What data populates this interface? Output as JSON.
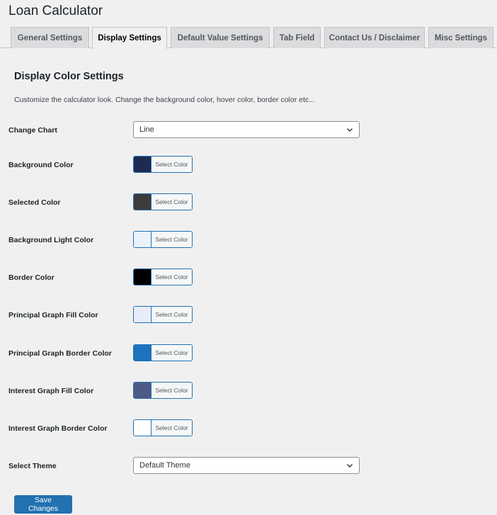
{
  "page": {
    "title": "Loan Calculator"
  },
  "tabs": [
    {
      "label": "General Settings",
      "active": false
    },
    {
      "label": "Display Settings",
      "active": true
    },
    {
      "label": "Default Value Settings",
      "active": false
    },
    {
      "label": "Tab Field",
      "active": false
    },
    {
      "label": "Contact Us / Disclaimer",
      "active": false
    },
    {
      "label": "Misc Settings",
      "active": false
    }
  ],
  "section": {
    "title": "Display Color Settings",
    "description": "Customize the calculator look. Change the background color, hover color, border color etc..."
  },
  "chart_select": {
    "label": "Change Chart",
    "value": "Line"
  },
  "color_button_label": "Select Color",
  "colors": [
    {
      "label": "Background Color",
      "color": "#1f2a52"
    },
    {
      "label": "Selected Color",
      "color": "#3c3c3e"
    },
    {
      "label": "Background Light Color",
      "color": "#eaf3fc"
    },
    {
      "label": "Border Color",
      "color": "#000000"
    },
    {
      "label": "Principal Graph Fill Color",
      "color": "#e8ecf9"
    },
    {
      "label": "Principal Graph Border Color",
      "color": "#1e73be"
    },
    {
      "label": "Interest Graph Fill Color",
      "color": "#4d5a85"
    },
    {
      "label": "Interest Graph Border Color",
      "color": "#ffffff"
    }
  ],
  "theme_select": {
    "label": "Select Theme",
    "value": "Default Theme"
  },
  "save_button": {
    "label": "Save Changes"
  }
}
